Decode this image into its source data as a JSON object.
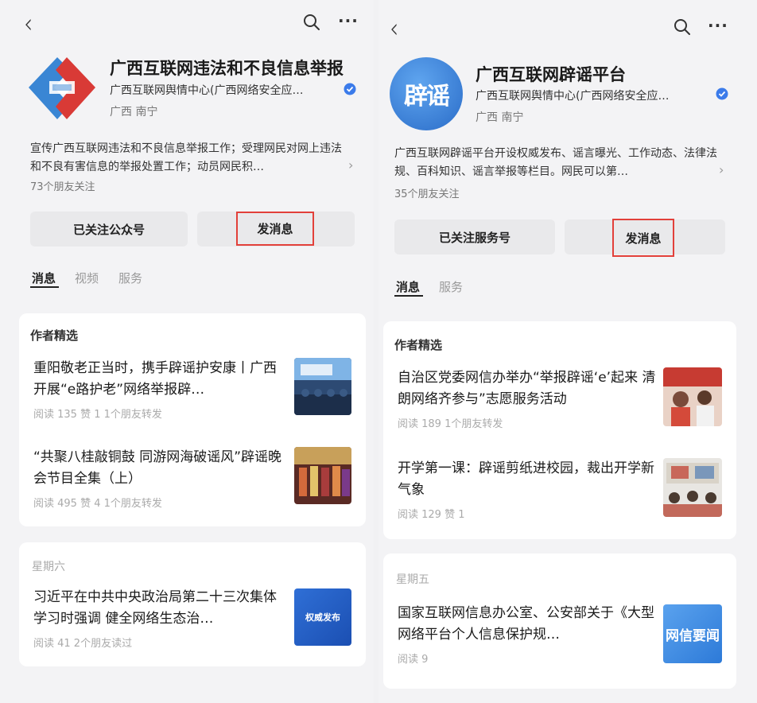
{
  "left": {
    "account": {
      "title": "广西互联网违法和不良信息举报",
      "org": "广西互联网舆情中心(广西网络安全应…",
      "location": "广西 南宁",
      "description": "宣传广西互联网违法和不良信息举报工作；受理网民对网上违法和不良有害信息的举报处置工作；动员网民积…",
      "friends": "73个朋友关注",
      "follow_label": "已关注公众号",
      "message_label": "发消息"
    },
    "tabs": [
      "消息",
      "视频",
      "服务"
    ],
    "section_title": "作者精选",
    "articles": [
      {
        "title": "重阳敬老正当时，携手辟谣护安康丨广西开展“e路护老”网络举报辟…",
        "stats": "阅读 135   赞 1   1个朋友转发"
      },
      {
        "title": "“共聚八桂敲铜鼓 同游网海破谣风”辟谣晚会节目全集（上）",
        "stats": "阅读 495   赞 4   1个朋友转发"
      }
    ],
    "day_label": "星期六",
    "day_article": {
      "title": "习近平在中共中央政治局第二十三次集体学习时强调 健全网络生态治…",
      "stats": "阅读 41   2个朋友读过",
      "thumb_text": "权威发布"
    }
  },
  "right": {
    "account": {
      "title": "广西互联网辟谣平台",
      "org": "广西互联网舆情中心(广西网络安全应…",
      "location": "广西 南宁",
      "description": "广西互联网辟谣平台开设权威发布、谣言曝光、工作动态、法律法规、百科知识、谣言举报等栏目。网民可以第…",
      "friends": "35个朋友关注",
      "follow_label": "已关注服务号",
      "message_label": "发消息",
      "logo_text": "辟谣"
    },
    "tabs": [
      "消息",
      "服务"
    ],
    "section_title": "作者精选",
    "articles": [
      {
        "title": "自治区党委网信办举办“举报辟谣‘e’起来 清朗网络齐参与”志愿服务活动",
        "stats": "阅读 189   1个朋友转发"
      },
      {
        "title": "开学第一课：辟谣剪纸进校园，裁出开学新气象",
        "stats": "阅读 129   赞 1"
      }
    ],
    "day_label": "星期五",
    "day_article": {
      "title": "国家互联网信息办公室、公安部关于《大型网络平台个人信息保护规…",
      "stats": "阅读 9",
      "thumb_text": "网信要闻"
    }
  },
  "icons": {
    "back": "back-icon",
    "search": "search-icon",
    "more": "more-icon",
    "verified": "verified-icon",
    "chevron": "chevron-right-icon"
  },
  "colors": {
    "accent_red": "#e2403a",
    "verified_blue": "#3b7bea",
    "background": "#f3f3f5"
  }
}
